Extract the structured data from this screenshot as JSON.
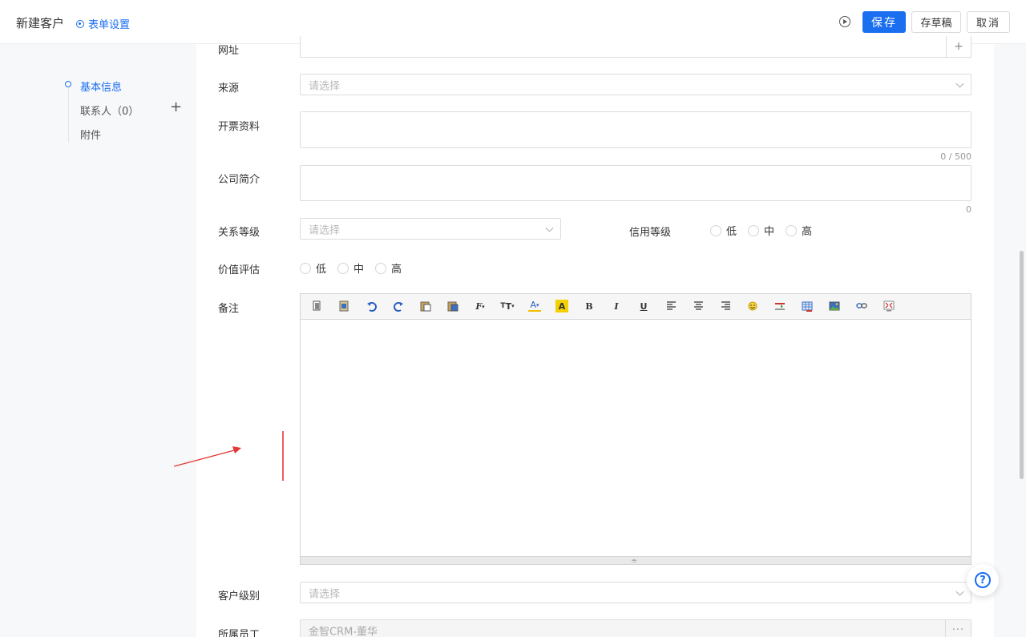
{
  "header": {
    "title": "新建客户",
    "form_settings": "表单设置",
    "save": "保存",
    "draft": "存草稿",
    "cancel": "取消"
  },
  "sidenav": {
    "items": [
      "基本信息",
      "联系人（0）",
      "附件"
    ]
  },
  "form": {
    "website": {
      "label": "网址",
      "value": ""
    },
    "source": {
      "label": "来源",
      "placeholder": "请选择"
    },
    "invoice": {
      "label": "开票资料",
      "counter": "0 / 500"
    },
    "intro": {
      "label": "公司简介",
      "counter": "0"
    },
    "relation_level": {
      "label": "关系等级",
      "placeholder": "请选择"
    },
    "credit_level": {
      "label": "信用等级",
      "options": [
        "低",
        "中",
        "高"
      ]
    },
    "value_eval": {
      "label": "价值评估",
      "options": [
        "低",
        "中",
        "高"
      ]
    },
    "remark": {
      "label": "备注"
    },
    "customer_level": {
      "label": "客户级别",
      "placeholder": "请选择"
    },
    "owner": {
      "label": "所属员工",
      "value": "金智CRM-董华"
    }
  },
  "toolbar_icons": [
    "cut-icon",
    "copy-icon",
    "undo-icon",
    "redo-icon",
    "paste-icon",
    "paste-text-icon",
    "font-family-icon",
    "font-size-icon",
    "font-color-icon",
    "highlight-icon",
    "bold-icon",
    "italic-icon",
    "underline-icon",
    "align-left-icon",
    "align-center-icon",
    "align-right-icon",
    "emoji-icon",
    "horizontal-rule-icon",
    "table-icon",
    "image-icon",
    "link-icon",
    "fullscreen-icon"
  ],
  "colors": {
    "accent": "#1a6ef0",
    "annotation": "#e53935"
  }
}
